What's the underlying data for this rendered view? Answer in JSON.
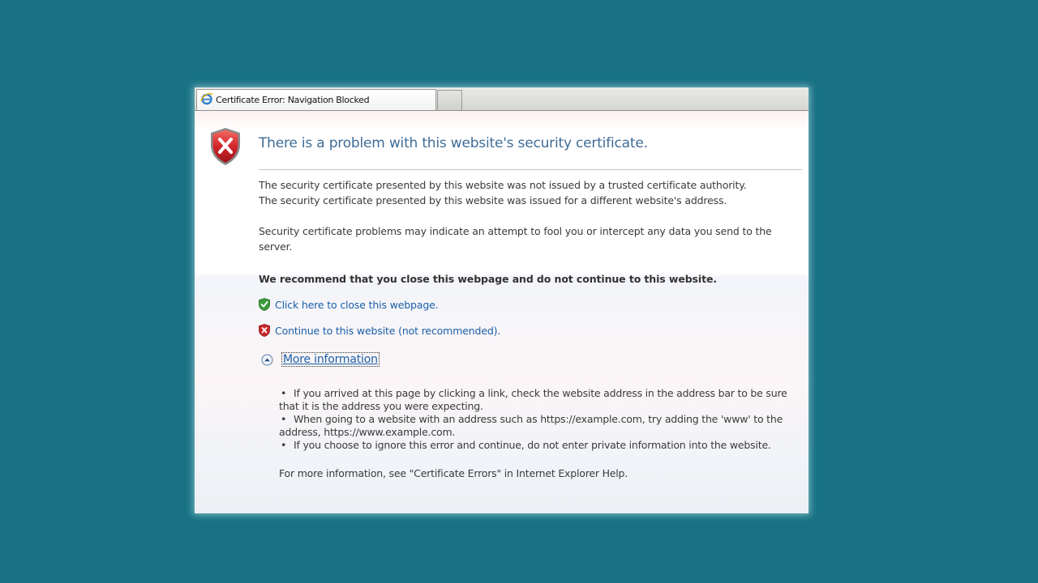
{
  "tab": {
    "title": "Certificate Error: Navigation Blocked",
    "icon": "ie-logo-icon"
  },
  "page": {
    "heading": "There is a problem with this website's security certificate.",
    "problems": [
      "The security certificate presented by this website was not issued by a trusted certificate authority.",
      "The security certificate presented by this website was issued for a different website's address."
    ],
    "warning": "Security certificate problems may indicate an attempt to fool you or intercept any data you send to the server.",
    "recommendation": "We recommend that you close this webpage and do not continue to this website.",
    "close_link": "Click here to close this webpage.",
    "continue_link": "Continue to this website (not recommended).",
    "more_info_label": "More information",
    "more_info_items": [
      "If you arrived at this page by clicking a link, check the website address in the address bar to be sure that it is the address you were expecting.",
      "When going to a website with an address such as https://example.com, try adding the 'www' to the address, https://www.example.com.",
      "If you choose to ignore this error and continue, do not enter private information into the website."
    ],
    "help_note": "For more information, see \"Certificate Errors\" in Internet Explorer Help."
  },
  "colors": {
    "desktop": "#187284",
    "heading": "#3f6c96",
    "link": "#1a5fa8",
    "error_red": "#c8262b",
    "safe_green": "#3a9a3a"
  }
}
